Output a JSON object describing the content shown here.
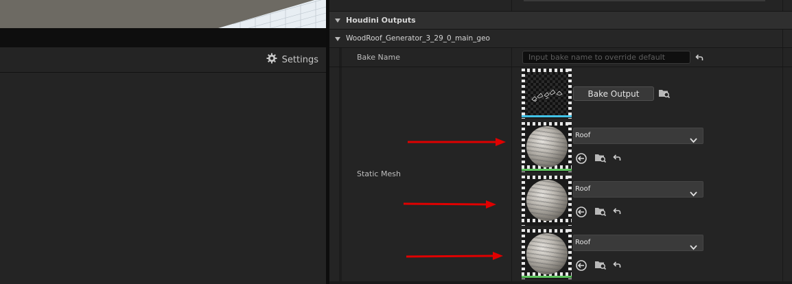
{
  "toolbar": {
    "settings_label": "Settings"
  },
  "details": {
    "section_title": "Houdini Outputs",
    "output_group": "WoodRoof_Generator_3_29_0_main_geo",
    "bake_name": {
      "label": "Bake Name",
      "value": "",
      "placeholder": "Input bake name to override default"
    },
    "bake_output_label": "Bake Output",
    "static_mesh_label": "Static Mesh",
    "materials": [
      {
        "slot_value": "Roof"
      },
      {
        "slot_value": "Roof"
      },
      {
        "slot_value": "Roof"
      }
    ]
  },
  "colors": {
    "accent_mesh": "#41c3e8",
    "accent_material": "#5ec45e",
    "annotation_arrow": "#e00000",
    "panel_bg": "#242424"
  },
  "icons": [
    "gear-icon",
    "reset-arrow-icon",
    "folder-browse-icon",
    "use-selected-icon",
    "chevron-down-icon",
    "expand-triangle-icon"
  ]
}
